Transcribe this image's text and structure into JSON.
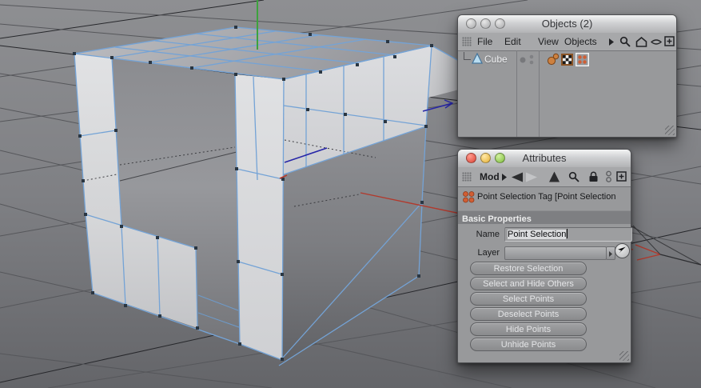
{
  "viewport": {
    "colors": {
      "background_top": "#8e8f92",
      "background_bottom": "#646569",
      "grid_line": "#56575b",
      "grid_line_dark": "#26272b",
      "wireframe": "#74a3d6",
      "face_light": "#dcdde0",
      "face_shadow": "#76777b",
      "axis_x": "#b2392c",
      "axis_y": "#3da23d",
      "axis_z": "#2726a8",
      "vertex_dot": "#2a3642"
    }
  },
  "objects_panel": {
    "title": "Objects (2)",
    "window_buttons": [
      "close",
      "minimize",
      "zoom"
    ],
    "menu": {
      "items": [
        "File",
        "Edit",
        "View",
        "Objects"
      ],
      "overflow": "▶"
    },
    "toolbar_icons": [
      "search",
      "home",
      "eye",
      "add"
    ],
    "tree": [
      {
        "label": "Cube",
        "icon": "cone",
        "tags": [
          "material-spheres-tag",
          "texture-checker-tag",
          "point-selection-tag"
        ],
        "selected_tag": "point-selection-tag"
      }
    ]
  },
  "attributes_panel": {
    "title": "Attributes",
    "mode": {
      "label": "Mod"
    },
    "toolbar_icons": [
      "back",
      "forward",
      "up",
      "search",
      "lock",
      "link",
      "add"
    ],
    "tag_header": {
      "icon": "point-selection-tag",
      "text": "Point Selection Tag [Point Selection"
    },
    "sections": [
      {
        "header": "Basic Properties",
        "fields": [
          {
            "label": "Name",
            "value": "Point Selection",
            "selected": true
          },
          {
            "label": "Layer",
            "value": ""
          }
        ]
      }
    ],
    "buttons": [
      "Restore Selection",
      "Select and Hide Others",
      "Select Points",
      "Deselect Points",
      "Hide Points",
      "Unhide Points"
    ]
  }
}
